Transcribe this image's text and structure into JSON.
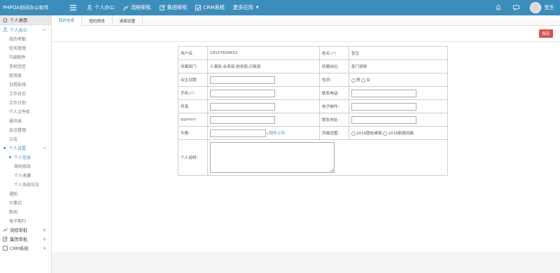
{
  "app": {
    "title": "PHPOA协同办公软件",
    "user": "张生"
  },
  "topnav": [
    {
      "label": "个人办公",
      "icon": "person-icon"
    },
    {
      "label": "流程审批",
      "icon": "workflow-icon"
    },
    {
      "label": "集团审批",
      "icon": "edit-icon"
    },
    {
      "label": "CRM系统",
      "icon": "crm-icon"
    },
    {
      "label": "更多应用",
      "icon": ""
    }
  ],
  "sidebar": {
    "home": "个人桌面",
    "personal": "个人办公",
    "items": [
      "我的考勤",
      "任务管理",
      "内部邮件",
      "手机短信",
      "短消息",
      "日程安排",
      "工作日志",
      "工作计划",
      "个人文件柜",
      "通讯录",
      "会议管理",
      "公告"
    ],
    "settings": "个人设置",
    "settings_items": [
      "个人信息",
      "密码修改",
      "个人收藏",
      "个人系统日志"
    ],
    "after_items": [
      "通知",
      "大事记",
      "新闻",
      "电子期刊"
    ],
    "groups": [
      "流程审批",
      "集团审批",
      "CRM系统"
    ]
  },
  "tabs": [
    "我的信息",
    "密码修改",
    "桌面设置"
  ],
  "toolbar": {
    "save": "保存"
  },
  "form": {
    "username_label": "用户名:",
    "username_value": "18107839632",
    "name_label": "姓名:",
    "name_req": "(*)",
    "name_value": "张生",
    "dept_label": "所属部门:",
    "dept_value": "人事部,业务部,财务部,行政部",
    "post_label": "所属岗位:",
    "post_value": "部门领导",
    "birthday_label": "出生日期:",
    "gender_label": "性别:",
    "male": "男",
    "female": "女",
    "phone_label": "手机:",
    "phone_req": "(*)",
    "tel_label": "联系电话:",
    "fax_label": "传真:",
    "email_label": "电子邮件:",
    "qq_label": "qq/msn:",
    "address_label": "联系地址:",
    "avatar_label": "头像:",
    "attach": "+附件上传",
    "style_label": "风格设置:",
    "style1": "2016图标桌面",
    "style2": "2018新版风格",
    "intro_label": "个人说明:"
  }
}
